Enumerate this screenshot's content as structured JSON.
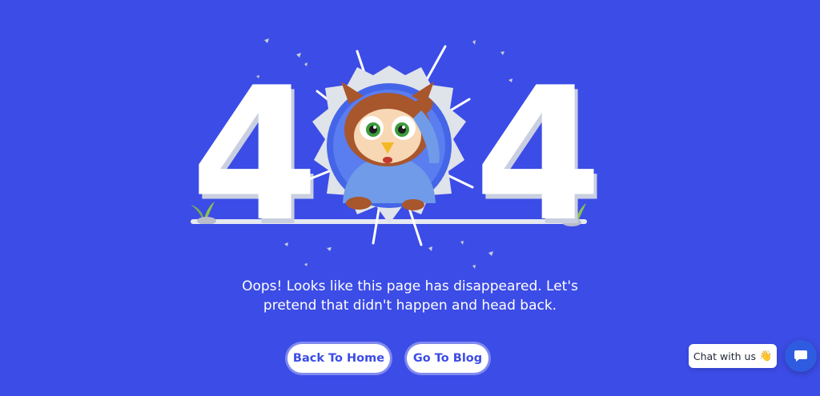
{
  "hero": {
    "digit_left": "4",
    "digit_right": "4"
  },
  "message": {
    "line1": "Oops! Looks like this page has disappeared. Let's",
    "line2": "pretend that didn't happen and head back."
  },
  "actions": {
    "home_label": "Back To Home",
    "blog_label": "Go To Blog"
  },
  "chat": {
    "label": "Chat with us",
    "emoji": "👋",
    "button_icon": "chat-bubble-icon"
  },
  "colors": {
    "background": "#3c4ce6",
    "button_text": "#3c4ce6",
    "chat_button": "#2f5be0"
  }
}
